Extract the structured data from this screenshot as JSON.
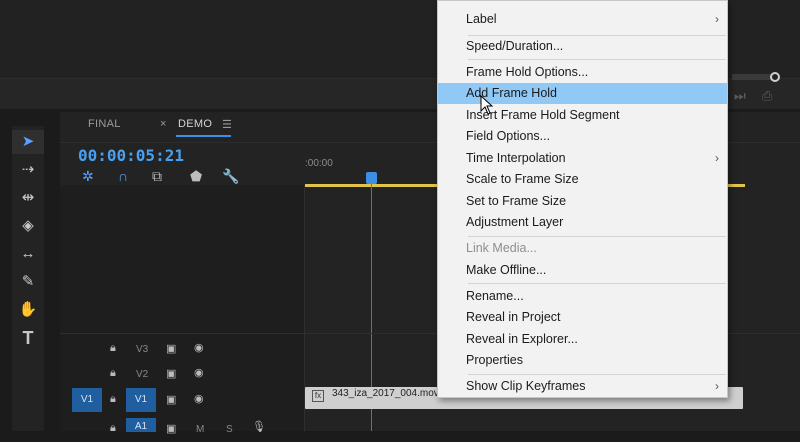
{
  "timeline": {
    "tabs": [
      "FINAL",
      "DEMO"
    ],
    "close_glyph": "×",
    "menu_glyph": "☰",
    "timecode": "00:00:05:21",
    "ruler_label": ":00:00",
    "tracks": {
      "v3": "V3",
      "v2": "V2",
      "v1_source": "V1",
      "v1_target": "V1",
      "a1": "A1",
      "m": "M",
      "s": "S"
    },
    "clip_name": "343_iza_2017_004.mov"
  },
  "context_menu": {
    "items": [
      {
        "label": "Label",
        "submenu": true
      },
      {
        "label": "Speed/Duration...",
        "submenu": false
      },
      {
        "label": "Frame Hold Options...",
        "submenu": false
      },
      {
        "label": "Add Frame Hold",
        "submenu": false,
        "highlighted": true
      },
      {
        "label": "Insert Frame Hold Segment",
        "submenu": false
      },
      {
        "label": "Field Options...",
        "submenu": false
      },
      {
        "label": "Time Interpolation",
        "submenu": true
      },
      {
        "label": "Scale to Frame Size",
        "submenu": false
      },
      {
        "label": "Set to Frame Size",
        "submenu": false
      },
      {
        "label": "Adjustment Layer",
        "submenu": false
      },
      {
        "label": "Link Media...",
        "submenu": false,
        "disabled": true
      },
      {
        "label": "Make Offline...",
        "submenu": false
      },
      {
        "label": "Rename...",
        "submenu": false
      },
      {
        "label": "Reveal in Project",
        "submenu": false
      },
      {
        "label": "Reveal in Explorer...",
        "submenu": false
      },
      {
        "label": "Properties",
        "submenu": false
      },
      {
        "label": "Show Clip Keyframes",
        "submenu": true
      }
    ],
    "submenu_glyph": "›",
    "highlight_color": "#90c8f6"
  },
  "tools": [
    "selection-tool-icon",
    "track-select-tool-icon",
    "ripple-edit-tool-icon",
    "razor-tool-icon",
    "slip-tool-icon",
    "pen-tool-icon",
    "hand-tool-icon",
    "type-tool-icon"
  ],
  "colors": {
    "accent": "#3b8fe5",
    "work_area": "#e3c44a",
    "timecode": "#4aa0f0"
  }
}
